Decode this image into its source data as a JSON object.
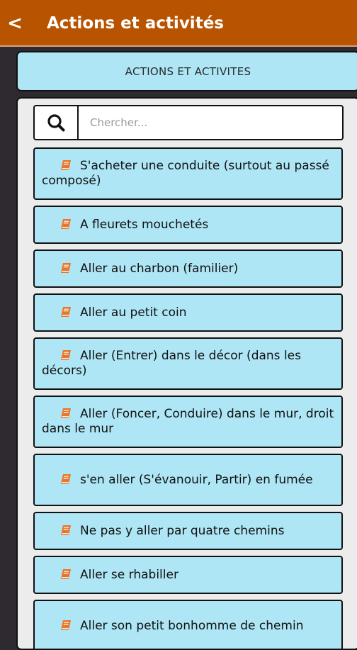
{
  "app_bar": {
    "back_glyph": "<",
    "title": "Actions et activités",
    "color": "#b85300"
  },
  "section": {
    "title": "ACTIONS ET ACTIVITES"
  },
  "search": {
    "icon": "search-icon",
    "placeholder": "Chercher..."
  },
  "list": {
    "item_icon": "book-icon",
    "item_icon_color": "#e8762a",
    "items": [
      {
        "label": "S'acheter une conduite (surtout au passé composé)"
      },
      {
        "label": "A fleurets mouchetés"
      },
      {
        "label": "Aller au charbon (familier)"
      },
      {
        "label": "Aller au petit coin"
      },
      {
        "label": "Aller (Entrer) dans le décor (dans les décors)"
      },
      {
        "label": "Aller (Foncer, Conduire) dans le mur, droit dans le mur"
      },
      {
        "label": "s'en aller (S'évanouir, Partir) en fumée"
      },
      {
        "label": "Ne pas y aller par quatre chemins"
      },
      {
        "label": "Aller se rhabiller"
      },
      {
        "label": "Aller son petit bonhomme de chemin"
      }
    ]
  }
}
